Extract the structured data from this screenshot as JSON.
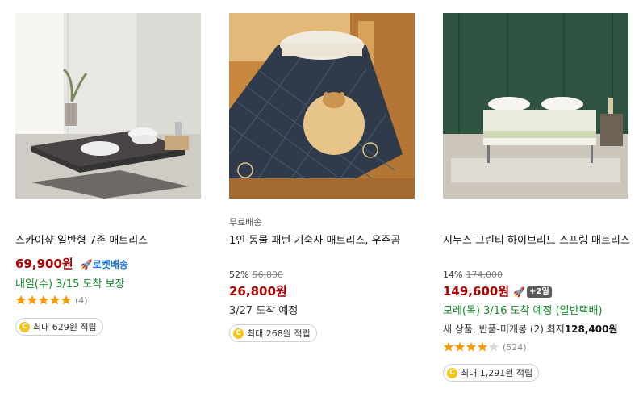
{
  "products": [
    {
      "image_alt": "mattress on floor by window",
      "title": "스카이샾 일반형 7존 매트리스",
      "price": "69,900원",
      "rocket_label": "로켓배송",
      "delivery": "내일(수) 3/15 도착 보장",
      "rating": 5,
      "review_count": "(4)",
      "reward": "최대 629원 적립"
    },
    {
      "badge": "무료배송",
      "title": "1인 동물 패턴 기숙사 매트리스, 우주곰",
      "discount_rate": "52%",
      "original_price": "56,800",
      "price": "26,800원",
      "delivery": "3/27 도착 예정",
      "reward": "최대 268원 적립"
    },
    {
      "title": "지누스 그린티 하이브리드 스프링 매트리스",
      "discount_rate": "14%",
      "original_price": "174,000",
      "price": "149,600원",
      "plus_badge": "+2일",
      "delivery": "모레(목) 3/16 도착 예정 (일반택배)",
      "seller_text": "새 상품, 반품-미개봉 (2) 최저",
      "seller_price": "128,400원",
      "rating": 4.5,
      "review_count": "(524)",
      "reward": "최대 1,291원 적립"
    }
  ],
  "colors": {
    "price": "#ae0000",
    "rocket": "#1a73e8",
    "delivery_green": "#138a2b",
    "star": "#f59a00",
    "coin": "#f5c518"
  }
}
